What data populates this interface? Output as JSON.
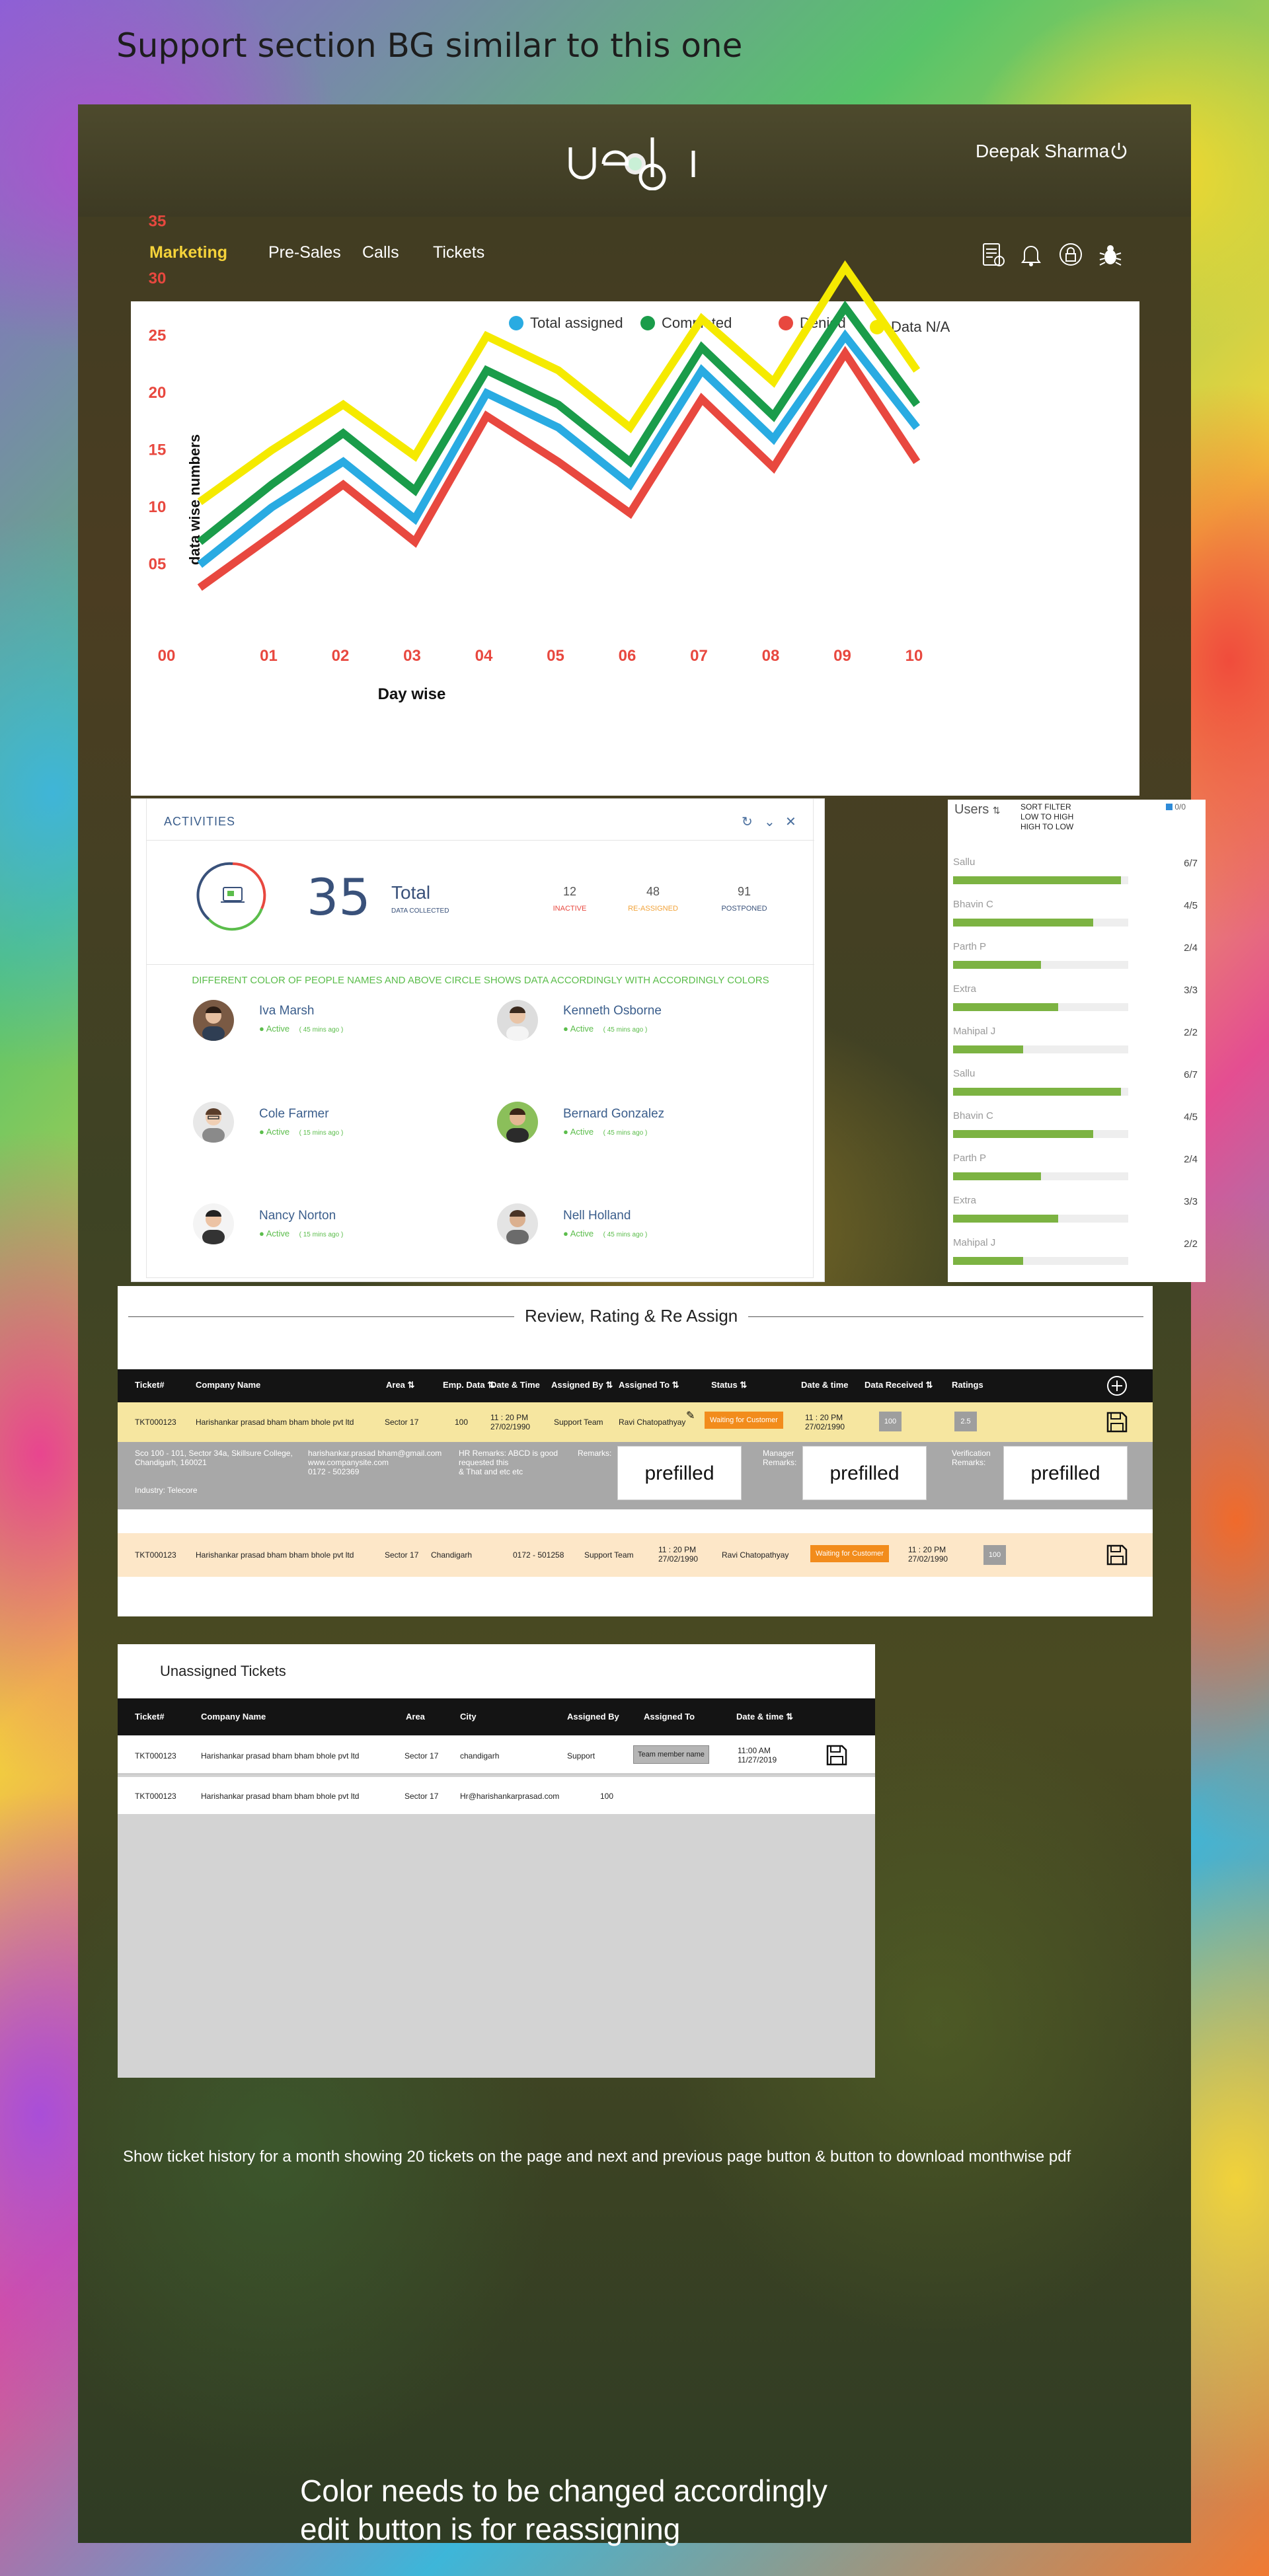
{
  "annotations": {
    "top_note": "Support section BG  similar to this one",
    "history_note": "Show  ticket history  for a month  showing 20 tickets on the page and  next and previous page button  & button to download monthwise pdf",
    "bottom_note_line1": "Color needs to be changed  accordingly",
    "bottom_note_line2": "edit button is for reassigning"
  },
  "header": {
    "logo_text": "ueibi",
    "user_name": "Deepak Sharma"
  },
  "nav": {
    "items": [
      {
        "label": "Marketing",
        "active": true
      },
      {
        "label": "Pre-Sales",
        "active": false
      },
      {
        "label": "Calls",
        "active": false
      },
      {
        "label": "Tickets",
        "active": false
      }
    ],
    "icons": [
      "report-icon",
      "bell-icon",
      "lock-icon",
      "bug-icon"
    ]
  },
  "chart_data": {
    "type": "line",
    "title": "",
    "xlabel": "Day wise",
    "ylabel": "data wise numbers",
    "x_ticks": [
      "00",
      "01",
      "02",
      "03",
      "04",
      "05",
      "06",
      "07",
      "08",
      "09",
      "10"
    ],
    "y_ticks": [
      "05",
      "10",
      "15",
      "20",
      "25",
      "30",
      "35"
    ],
    "y_zero_label": "00",
    "ylim": [
      0,
      35
    ],
    "x": [
      0.5,
      1.5,
      2.5,
      3.5,
      4.5,
      5.5,
      6.5,
      7.5,
      8.5,
      9.5,
      10.5
    ],
    "legend_position": "top",
    "series": [
      {
        "name": "Total assigned",
        "color": "#29abe2",
        "values": [
          5,
          10,
          14,
          9,
          20,
          17,
          12,
          22,
          16,
          25,
          17
        ]
      },
      {
        "name": "Completed",
        "color": "#1a9c4a",
        "values": [
          7,
          12,
          16.5,
          11.5,
          22,
          19,
          14,
          24,
          18,
          27.5,
          19
        ]
      },
      {
        "name": "Denied",
        "color": "#e8483f",
        "values": [
          3,
          7.5,
          12,
          7,
          18,
          14,
          9.5,
          19.5,
          13.5,
          23.5,
          14
        ]
      },
      {
        "name": "Data N/A",
        "color": "#f5ea00",
        "values": [
          10.5,
          15,
          19,
          14.5,
          25,
          22,
          17,
          26.5,
          21,
          31,
          22
        ]
      }
    ]
  },
  "activities": {
    "title": "ACTIVITIES",
    "total_number": "35",
    "total_label": "Total",
    "total_sub": "DATA COLLECTED",
    "stats": [
      {
        "value": "12",
        "label": "INACTIVE",
        "color": "#e8483f"
      },
      {
        "value": "48",
        "label": "RE-ASSIGNED",
        "color": "#f2a33a"
      },
      {
        "value": "91",
        "label": "POSTPONED",
        "color": "#39517a"
      }
    ],
    "note": "DIFFERENT COLOR OF PEOPLE NAMES  AND ABOVE CIRCLE SHOWS DATA ACCORDINGLY WITH ACCORDINGLY COLORS",
    "people": [
      {
        "name": "Iva Marsh",
        "status": "Active",
        "time": "( 45 mins ago )"
      },
      {
        "name": "Kenneth Osborne",
        "status": "Active",
        "time": "( 45 mins ago )"
      },
      {
        "name": "Cole Farmer",
        "status": "Active",
        "time": "( 15 mins ago )"
      },
      {
        "name": "Bernard Gonzalez",
        "status": "Active",
        "time": "( 45 mins ago )"
      },
      {
        "name": "Nancy Norton",
        "status": "Active",
        "time": "( 15 mins ago )"
      },
      {
        "name": "Nell Holland",
        "status": "Active",
        "time": "( 45 mins ago )"
      }
    ]
  },
  "users_panel": {
    "title": "Users",
    "sort_line1": "SORT FILTER",
    "sort_line2": "LOW TO HIGH",
    "sort_line3": "HIGH TO LOW",
    "legend": "0/0",
    "rows": [
      {
        "name": "Sallu",
        "value": "6/7",
        "fill": 0.96
      },
      {
        "name": "Bhavin C",
        "value": "4/5",
        "fill": 0.8
      },
      {
        "name": "Parth P",
        "value": "2/4",
        "fill": 0.5
      },
      {
        "name": "Extra",
        "value": "3/3",
        "fill": 0.6
      },
      {
        "name": "Mahipal J",
        "value": "2/2",
        "fill": 0.4
      },
      {
        "name": "Sallu",
        "value": "6/7",
        "fill": 0.96
      },
      {
        "name": "Bhavin C",
        "value": "4/5",
        "fill": 0.8
      },
      {
        "name": "Parth P",
        "value": "2/4",
        "fill": 0.5
      },
      {
        "name": "Extra",
        "value": "3/3",
        "fill": 0.6
      },
      {
        "name": "Mahipal J",
        "value": "2/2",
        "fill": 0.4
      }
    ]
  },
  "review": {
    "title": "Review, Rating & Re Assign",
    "headers": [
      "Ticket#",
      "Company Name",
      "Area",
      "Emp. Data",
      "Date & Time",
      "Assigned  By",
      "Assigned To",
      "Status",
      "Date & time",
      "Data Received",
      "Ratings"
    ],
    "row1": {
      "ticket": "TKT000123",
      "company": "Harishankar prasad bham bham bhole pvt ltd",
      "area": "Sector 17",
      "emp": "100",
      "datetime_1": "11 : 20 PM",
      "datetime_2": "27/02/1990",
      "assigned_by": "Support Team",
      "assigned_to": "Ravi Chatopathyay",
      "status": "Waiting for Customer",
      "date2_1": "11 : 20 PM",
      "date2_2": "27/02/1990",
      "received": "100",
      "rating": "2.5"
    },
    "detail": {
      "address_1": "Sco 100 - 101, Sector 34a, Skillsure College,",
      "address_2": "Chandigarh, 160021",
      "industry": "Industry: Telecore",
      "contact_1": "harishankar.prasad bham@gmail.com",
      "contact_2": "www.companysite.com",
      "contact_3": "0172 - 502369",
      "hr_1": "HR Remarks:  ABCD is good",
      "hr_2": "requested this",
      "hr_3": "& That and etc etc",
      "remarks_label": "Remarks:",
      "manager_label_1": "Manager",
      "manager_label_2": "Remarks:",
      "verification_label_1": "Verification",
      "verification_label_2": "Remarks:",
      "prefilled": "prefilled"
    },
    "row2": {
      "ticket": "TKT000123",
      "company": "Harishankar prasad bham bham bhole pvt ltd",
      "area": "Sector 17",
      "city": "Chandigarh",
      "phone": "0172 - 501258",
      "assigned_by": "Support Team",
      "datetime_1": "11 : 20 PM",
      "datetime_2": "27/02/1990",
      "assigned_to": "Ravi Chatopathyay",
      "status": "Waiting for Customer",
      "date2_1": "11 : 20 PM",
      "date2_2": "27/02/1990",
      "received": "100"
    }
  },
  "unassigned": {
    "title": "Unassigned Tickets",
    "headers": [
      "Ticket#",
      "Company Name",
      "Area",
      "City",
      "Assigned  By",
      "Assigned To",
      "Date & time"
    ],
    "rows": [
      {
        "ticket": "TKT000123",
        "company": "Harishankar prasad bham bham bhole pvt ltd",
        "area": "Sector 17",
        "city": "chandigarh",
        "assigned_by": "Support",
        "assigned_to": "Team member name",
        "date_1": "11:00 AM",
        "date_2": "11/27/2019"
      },
      {
        "ticket": "TKT000123",
        "company": "Harishankar prasad bham bham bhole pvt ltd",
        "area": "Sector 17",
        "city": "Hr@harishankarprasad.com",
        "assigned_by": "100"
      }
    ]
  }
}
